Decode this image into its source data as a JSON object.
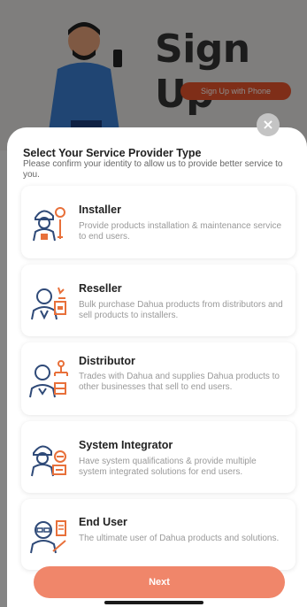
{
  "background": {
    "title": "Sign Up",
    "phone_button_label": "Sign Up with Phone"
  },
  "modal": {
    "close_symbol": "×",
    "title": "Select Your Service Provider Type",
    "subtitle": "Please confirm your identity to allow us to provide better service to you.",
    "options": [
      {
        "title": "Installer",
        "description": "Provide products installation & maintenance service to end users.",
        "icon": "installer-icon"
      },
      {
        "title": "Reseller",
        "description": "Bulk purchase Dahua products from distributors and sell products to installers.",
        "icon": "reseller-icon"
      },
      {
        "title": "Distributor",
        "description": "Trades with Dahua and supplies Dahua products to other businesses that sell to end users.",
        "icon": "distributor-icon"
      },
      {
        "title": "System Integrator",
        "description": "Have system qualifications & provide multiple system integrated solutions for end users.",
        "icon": "system-integrator-icon"
      },
      {
        "title": "End User",
        "description": "The ultimate user of Dahua products and solutions.",
        "icon": "end-user-icon"
      }
    ],
    "next_label": "Next"
  },
  "colors": {
    "accent": "#e8552c",
    "next_button": "#f0866a",
    "icon_orange": "#e8703a",
    "icon_blue": "#2f4a78"
  }
}
